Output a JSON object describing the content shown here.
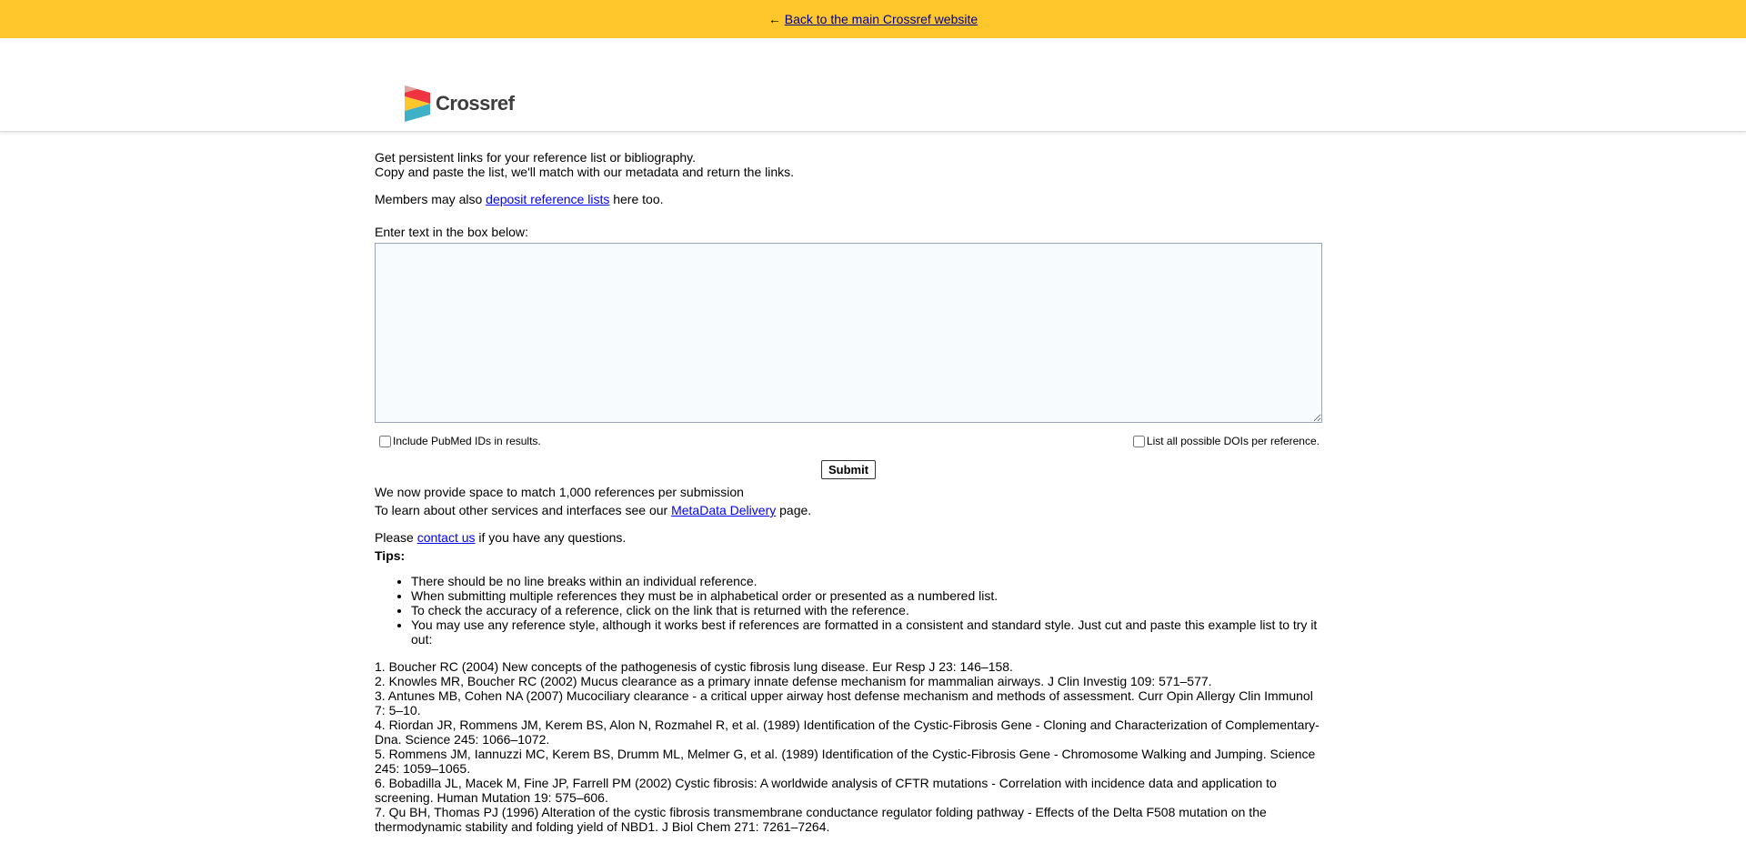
{
  "topbar": {
    "arrow": "←",
    "link_label": "Back to the main Crossref website"
  },
  "logo": {
    "text": "Crossref",
    "colors": [
      "#ef3340",
      "#ffc72c",
      "#3eb1c8",
      "#d8d2c4"
    ]
  },
  "intro": {
    "line1": "Get persistent links for your reference list or bibliography.",
    "line2": "Copy and paste the list, we'll match with our metadata and return the links.",
    "members_prefix": "Members may also ",
    "members_link": "deposit reference lists",
    "members_suffix": " here too."
  },
  "form": {
    "textarea_label": "Enter text in the box below:",
    "textarea_value": "",
    "pubmed_label": "Include PubMed IDs in results.",
    "pubmed_checked": false,
    "alldois_label": "List all possible DOIs per reference.",
    "alldois_checked": false,
    "submit_label": "Submit"
  },
  "info": {
    "capacity": "We now provide space to match 1,000 references per submission",
    "services_prefix": "To learn about other services and interfaces see our ",
    "services_link": "MetaData Delivery",
    "services_suffix": " page.",
    "contact_prefix": "Please ",
    "contact_link": "contact us",
    "contact_suffix": " if you have any questions."
  },
  "tips": {
    "heading": "Tips:",
    "items": [
      "There should be no line breaks within an individual reference.",
      "When submitting multiple references they must be in alphabetical order or presented as a numbered list.",
      "To check the accuracy of a reference, click on the link that is returned with the reference.",
      "You may use any reference style, although it works best if references are formatted in a consistent and standard style. Just cut and paste this example list to try it out:"
    ]
  },
  "examples": [
    "1. Boucher RC (2004) New concepts of the pathogenesis of cystic fibrosis lung disease. Eur Resp J 23: 146–158.",
    "2. Knowles MR, Boucher RC (2002) Mucus clearance as a primary innate defense mechanism for mammalian airways. J Clin Investig 109: 571–577.",
    "3. Antunes MB, Cohen NA (2007) Mucociliary clearance - a critical upper airway host defense mechanism and methods of assessment. Curr Opin Allergy Clin Immunol 7: 5–10.",
    "4. Riordan JR, Rommens JM, Kerem BS, Alon N, Rozmahel R, et al. (1989) Identification of the Cystic-Fibrosis Gene - Cloning and Characterization of Complementary-Dna. Science 245: 1066–1072.",
    "5. Rommens JM, Iannuzzi MC, Kerem BS, Drumm ML, Melmer G, et al. (1989) Identification of the Cystic-Fibrosis Gene - Chromosome Walking and Jumping. Science 245: 1059–1065.",
    "6. Bobadilla JL, Macek M, Fine JP, Farrell PM (2002) Cystic fibrosis: A worldwide analysis of CFTR mutations - Correlation with incidence data and application to screening. Human Mutation 19: 575–606.",
    "7. Qu BH, Thomas PJ (1996) Alteration of the cystic fibrosis transmembrane conductance regulator folding pathway - Effects of the Delta F508 mutation on the thermodynamic stability and folding yield of NBD1. J Biol Chem 271: 7261–7264."
  ]
}
